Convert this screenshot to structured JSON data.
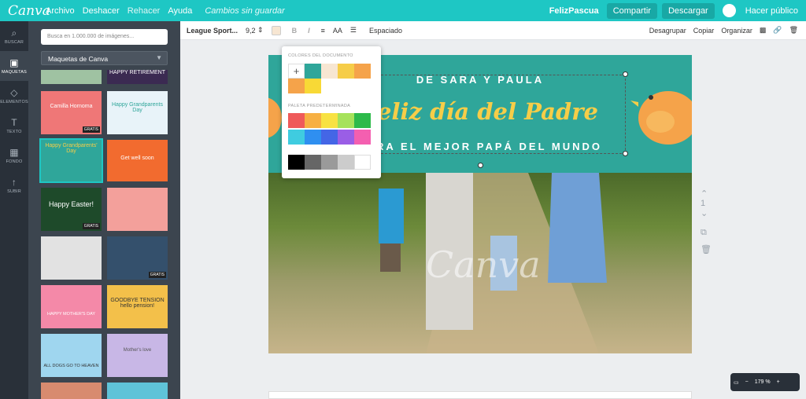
{
  "topbar": {
    "logo": "Canva",
    "menu": [
      "Archivo",
      "Deshacer",
      "Rehacer",
      "Ayuda"
    ],
    "status": "Cambios sin guardar",
    "title": "FelizPascua",
    "share": "Compartir",
    "download": "Descargar",
    "publish": "Hacer público"
  },
  "rail": [
    {
      "icon": "search-icon",
      "label": "BUSCAR"
    },
    {
      "icon": "layouts-icon",
      "label": "MAQUETAS"
    },
    {
      "icon": "elements-icon",
      "label": "ELEMENTOS"
    },
    {
      "icon": "text-icon",
      "label": "TEXTO"
    },
    {
      "icon": "background-icon",
      "label": "FONDO"
    },
    {
      "icon": "upload-icon",
      "label": "SUBIR"
    }
  ],
  "panel": {
    "search_placeholder": "Busca en 1.000.000 de imágenes...",
    "dropdown": "Maquetas de Canva"
  },
  "thumbs": [
    {
      "text": "",
      "color": "#9fc2a2"
    },
    {
      "text": "HAPPY RETIREMENT",
      "color": "#3b2a52"
    },
    {
      "text": "Camilla Hornoma",
      "color": "#ef7777",
      "badge": "GRATIS"
    },
    {
      "text": "Happy Grandparents Day",
      "color": "#e8f3f9"
    },
    {
      "text": "Happy Grandparents' Day",
      "color": "#2fa69a"
    },
    {
      "text": "Get well soon",
      "color": "#f26b2f"
    },
    {
      "text": "Happy Easter!",
      "color": "#1e4a2a",
      "badge": "GRATIS"
    },
    {
      "text": "",
      "color": "#f3a09b"
    },
    {
      "text": "",
      "color": "#e2e2e2"
    },
    {
      "text": "",
      "color": "#34506c",
      "badge": "GRATIS"
    },
    {
      "text": "HAPPY MOTHER'S DAY",
      "color": "#f489a8"
    },
    {
      "text": "GOODBYE TENSION hello pension!",
      "color": "#f3c04a"
    },
    {
      "text": "ALL DOGS GO TO HEAVEN",
      "color": "#9fd6ef"
    },
    {
      "text": "Mother's love",
      "color": "#c8b7e6"
    },
    {
      "text": "",
      "color": "#d88b6f"
    },
    {
      "text": "",
      "color": "#5fc3d8"
    }
  ],
  "toolbar": {
    "font": "League Sport...",
    "size": "9,2",
    "bold": "B",
    "italic": "I",
    "case": "AA",
    "spacing": "Espaciado",
    "ungroup": "Desagrupar",
    "copy": "Copiar",
    "arrange": "Organizar"
  },
  "canvas": {
    "line1": "DE SARA Y PAULA",
    "line2": "Feliz día del Padre",
    "line3": "PARA EL MEJOR PAPÁ DEL MUNDO",
    "watermark": "Canva"
  },
  "popup": {
    "doc_title": "COLORES DEL DOCUMENTO",
    "pal_title": "PALETA PREDETERMINADA",
    "doc_colors": [
      "#2fa69a",
      "#f7e6d2",
      "#f6cd48",
      "#f5a34a",
      "#f5a34a",
      "#f8d936"
    ],
    "palette": [
      "#ef5a5a",
      "#f7b043",
      "#f8e243",
      "#a6e25b",
      "#2dba4a",
      "#3fcce0",
      "#2f8ff0",
      "#4466e6",
      "#9a5ee6",
      "#f45fb0",
      "#000000",
      "#666666",
      "#9a9a9a",
      "#cccccc",
      "#ffffff"
    ]
  },
  "sidectl": {
    "page": "1"
  },
  "zoom": {
    "value": "179 %"
  },
  "colors": {
    "teal": "#1ec7c4",
    "dark": "#293039",
    "panel": "#3c454f"
  }
}
